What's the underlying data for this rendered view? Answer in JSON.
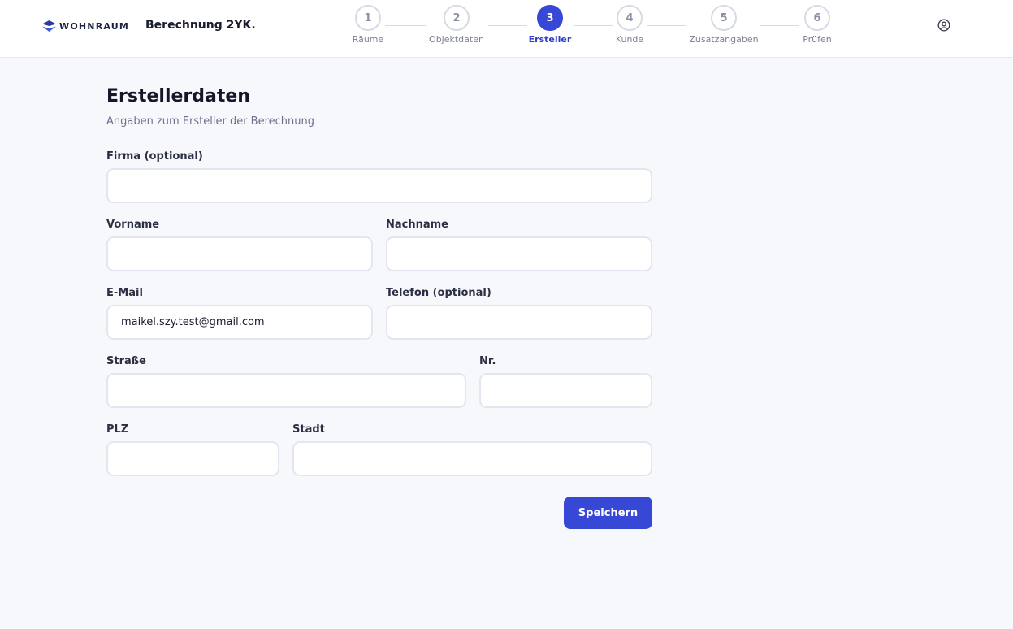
{
  "header": {
    "logo_text": "WOHNRAUM",
    "project_title": "Berechnung 2YK..."
  },
  "stepper": {
    "steps": [
      {
        "number": "1",
        "label": "Räume",
        "state": "pending"
      },
      {
        "number": "2",
        "label": "Objektdaten",
        "state": "pending"
      },
      {
        "number": "3",
        "label": "Ersteller",
        "state": "active"
      },
      {
        "number": "4",
        "label": "Kunde",
        "state": "pending"
      },
      {
        "number": "5",
        "label": "Zusatzangaben",
        "state": "pending"
      },
      {
        "number": "6",
        "label": "Prüfen",
        "state": "pending"
      }
    ]
  },
  "form": {
    "title": "Erstellerdaten",
    "subtitle": "Angaben zum Ersteller der Berechnung",
    "fields": {
      "firma": {
        "label": "Firma (optional)",
        "value": ""
      },
      "vorname": {
        "label": "Vorname",
        "value": ""
      },
      "nachname": {
        "label": "Nachname",
        "value": ""
      },
      "email": {
        "label": "E-Mail",
        "value": "maikel.szy.test@gmail.com"
      },
      "telefon": {
        "label": "Telefon (optional)",
        "value": ""
      },
      "strasse": {
        "label": "Straße",
        "value": ""
      },
      "nr": {
        "label": "Nr.",
        "value": ""
      },
      "plz": {
        "label": "PLZ",
        "value": ""
      },
      "stadt": {
        "label": "Stadt",
        "value": ""
      }
    },
    "save_label": "Speichern"
  },
  "colors": {
    "accent": "#3747d6",
    "background": "#f7f8fb",
    "border": "#e3e6ee"
  },
  "icons": {
    "logo": "wohnraum-logo-icon",
    "user": "user-circle-icon"
  }
}
